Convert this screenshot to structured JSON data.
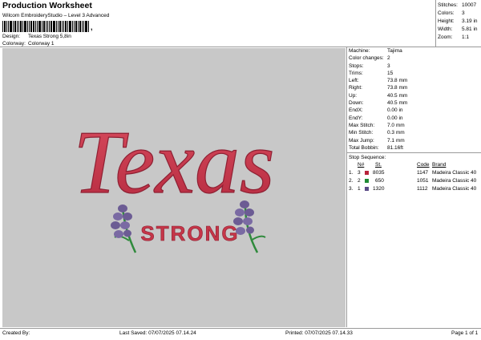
{
  "header": {
    "title": "Production Worksheet",
    "subtitle": "Wilcom EmbroideryStudio – Level 3 Advanced",
    "barcode_suffix": ","
  },
  "design": {
    "label": "Design:",
    "value": "Texas Strong 5,8in"
  },
  "colorway": {
    "label": "Colorway:",
    "value": "Colorway 1"
  },
  "stats": [
    {
      "label": "Stitches:",
      "value": "10007"
    },
    {
      "label": "Colors:",
      "value": "3"
    },
    {
      "label": "Height:",
      "value": "3.19 in"
    },
    {
      "label": "Width:",
      "value": "5.81 in"
    },
    {
      "label": "Zoom:",
      "value": "1:1"
    }
  ],
  "artwork": {
    "word1": "Texas",
    "word2": "STRONG",
    "colors": {
      "red": "#c53648",
      "red_dark": "#8e2033",
      "purple": "#6c5c94",
      "green": "#2f8a3c",
      "canvas": "#c8c8c8"
    }
  },
  "machine": [
    {
      "label": "Machine:",
      "value": "Tajima"
    },
    {
      "label": "Color changes:",
      "value": "2"
    },
    {
      "label": "Stops:",
      "value": "3"
    },
    {
      "label": "Trims:",
      "value": "15"
    },
    {
      "label": "Left:",
      "value": "73.8 mm"
    },
    {
      "label": "Right:",
      "value": "73.8 mm"
    },
    {
      "label": "Up:",
      "value": "40.5 mm"
    },
    {
      "label": "Down:",
      "value": "40.5 mm"
    },
    {
      "label": "EndX:",
      "value": "0.00 in"
    },
    {
      "label": "EndY:",
      "value": "0.00 in"
    },
    {
      "label": "Max Stitch:",
      "value": "7.0 mm"
    },
    {
      "label": "Min Stitch:",
      "value": "0.3 mm"
    },
    {
      "label": "Max Jump:",
      "value": "7.1 mm"
    },
    {
      "label": "Total Bobbin:",
      "value": "81.16ft"
    }
  ],
  "stop_sequence": {
    "title": "Stop Sequence:",
    "headers": {
      "num": "N#",
      "st": "St.",
      "code": "Code",
      "brand": "Brand"
    },
    "rows": [
      {
        "index": "1.",
        "num": "3",
        "color": "#b8223a",
        "st": "8035",
        "code": "1147",
        "brand": "Madeira Classic 40"
      },
      {
        "index": "2.",
        "num": "2",
        "color": "#1f8a34",
        "st": "650",
        "code": "1051",
        "brand": "Madeira Classic 40"
      },
      {
        "index": "3.",
        "num": "1",
        "color": "#5a4a86",
        "st": "1320",
        "code": "1112",
        "brand": "Madeira Classic 40"
      }
    ]
  },
  "footer": {
    "created": "Created By:",
    "saved": "Last Saved: 07/07/2025 07.14.24",
    "printed": "Printed: 07/07/2025 07.14.33",
    "page": "Page 1 of 1"
  }
}
